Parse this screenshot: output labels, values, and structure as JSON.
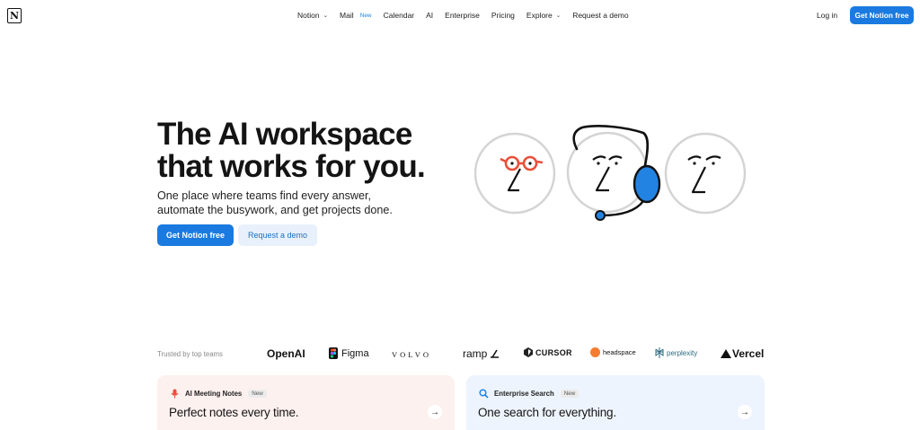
{
  "nav": {
    "logo_letter": "N",
    "items": [
      {
        "label": "Notion",
        "has_chevron": true
      },
      {
        "label": "Mail",
        "badge": "New"
      },
      {
        "label": "Calendar"
      },
      {
        "label": "AI"
      },
      {
        "label": "Enterprise"
      },
      {
        "label": "Pricing"
      },
      {
        "label": "Explore",
        "has_chevron": true
      },
      {
        "label": "Request a demo"
      }
    ],
    "chevron_glyph": "⌄",
    "login_label": "Log in",
    "cta_label": "Get Notion free"
  },
  "hero": {
    "title_line1": "The AI workspace",
    "title_line2": "that works for you.",
    "subtitle_line1": "One place where teams find every answer,",
    "subtitle_line2": "automate the busywork, and get projects done.",
    "primary_cta": "Get Notion free",
    "secondary_cta": "Request a demo"
  },
  "trusted": {
    "label": "Trusted by top teams",
    "logos": {
      "openai": "OpenAI",
      "figma": "Figma",
      "volvo": "VOLVO",
      "ramp": "ramp",
      "cursor": "CURSOR",
      "headspace": "headspace",
      "perplexity": "perplexity",
      "vercel": "Vercel"
    }
  },
  "cards": [
    {
      "tag": "AI Meeting Notes",
      "badge": "New",
      "title": "Perfect notes every time.",
      "icon": "microphone-icon",
      "arrow": "→"
    },
    {
      "tag": "Enterprise Search",
      "badge": "New",
      "title": "One search for everything.",
      "icon": "search-icon",
      "arrow": "→"
    }
  ],
  "colors": {
    "primary": "#1b7ae0",
    "secondary_bg": "#e8f1fb",
    "card_a_bg": "#fdf1ef",
    "card_b_bg": "#eef4fd",
    "accent_red": "#e8503a",
    "accent_blue": "#2383e2"
  }
}
